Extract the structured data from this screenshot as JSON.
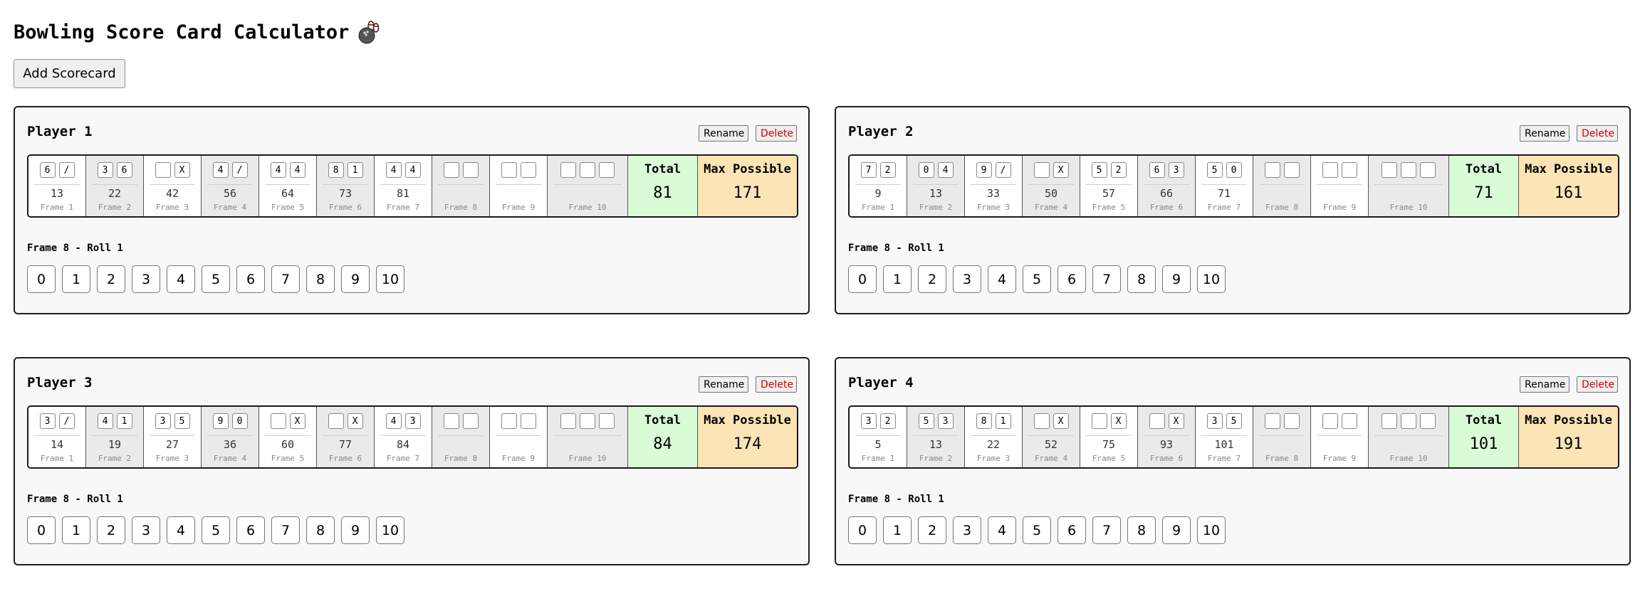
{
  "app": {
    "title": "Bowling Score Card Calculator",
    "add_label": "Add Scorecard",
    "rename_label": "Rename",
    "delete_label": "Delete",
    "total_label": "Total",
    "max_label": "Max Possible",
    "frame_labels": [
      "Frame 1",
      "Frame 2",
      "Frame 3",
      "Frame 4",
      "Frame 5",
      "Frame 6",
      "Frame 7",
      "Frame 8",
      "Frame 9",
      "Frame 10"
    ],
    "pin_options": [
      "0",
      "1",
      "2",
      "3",
      "4",
      "5",
      "6",
      "7",
      "8",
      "9",
      "10"
    ]
  },
  "players": [
    {
      "name": "Player 1",
      "frames": [
        {
          "rolls": [
            "6",
            "/"
          ],
          "score": "13"
        },
        {
          "rolls": [
            "3",
            "6"
          ],
          "score": "22"
        },
        {
          "rolls": [
            "",
            "X"
          ],
          "score": "42"
        },
        {
          "rolls": [
            "4",
            "/"
          ],
          "score": "56"
        },
        {
          "rolls": [
            "4",
            "4"
          ],
          "score": "64"
        },
        {
          "rolls": [
            "8",
            "1"
          ],
          "score": "73"
        },
        {
          "rolls": [
            "4",
            "4"
          ],
          "score": "81"
        },
        {
          "rolls": [
            "",
            ""
          ],
          "score": ""
        },
        {
          "rolls": [
            "",
            ""
          ],
          "score": ""
        },
        {
          "rolls": [
            "",
            "",
            ""
          ],
          "score": ""
        }
      ],
      "total": "81",
      "max_possible": "171",
      "prompt": "Frame 8 - Roll 1"
    },
    {
      "name": "Player 2",
      "frames": [
        {
          "rolls": [
            "7",
            "2"
          ],
          "score": "9"
        },
        {
          "rolls": [
            "0",
            "4"
          ],
          "score": "13"
        },
        {
          "rolls": [
            "9",
            "/"
          ],
          "score": "33"
        },
        {
          "rolls": [
            "",
            "X"
          ],
          "score": "50"
        },
        {
          "rolls": [
            "5",
            "2"
          ],
          "score": "57"
        },
        {
          "rolls": [
            "6",
            "3"
          ],
          "score": "66"
        },
        {
          "rolls": [
            "5",
            "0"
          ],
          "score": "71"
        },
        {
          "rolls": [
            "",
            ""
          ],
          "score": ""
        },
        {
          "rolls": [
            "",
            ""
          ],
          "score": ""
        },
        {
          "rolls": [
            "",
            "",
            ""
          ],
          "score": ""
        }
      ],
      "total": "71",
      "max_possible": "161",
      "prompt": "Frame 8 - Roll 1"
    },
    {
      "name": "Player 3",
      "frames": [
        {
          "rolls": [
            "3",
            "/"
          ],
          "score": "14"
        },
        {
          "rolls": [
            "4",
            "1"
          ],
          "score": "19"
        },
        {
          "rolls": [
            "3",
            "5"
          ],
          "score": "27"
        },
        {
          "rolls": [
            "9",
            "0"
          ],
          "score": "36"
        },
        {
          "rolls": [
            "",
            "X"
          ],
          "score": "60"
        },
        {
          "rolls": [
            "",
            "X"
          ],
          "score": "77"
        },
        {
          "rolls": [
            "4",
            "3"
          ],
          "score": "84"
        },
        {
          "rolls": [
            "",
            ""
          ],
          "score": ""
        },
        {
          "rolls": [
            "",
            ""
          ],
          "score": ""
        },
        {
          "rolls": [
            "",
            "",
            ""
          ],
          "score": ""
        }
      ],
      "total": "84",
      "max_possible": "174",
      "prompt": "Frame 8 - Roll 1"
    },
    {
      "name": "Player 4",
      "frames": [
        {
          "rolls": [
            "3",
            "2"
          ],
          "score": "5"
        },
        {
          "rolls": [
            "5",
            "3"
          ],
          "score": "13"
        },
        {
          "rolls": [
            "8",
            "1"
          ],
          "score": "22"
        },
        {
          "rolls": [
            "",
            "X"
          ],
          "score": "52"
        },
        {
          "rolls": [
            "",
            "X"
          ],
          "score": "75"
        },
        {
          "rolls": [
            "",
            "X"
          ],
          "score": "93"
        },
        {
          "rolls": [
            "3",
            "5"
          ],
          "score": "101"
        },
        {
          "rolls": [
            "",
            ""
          ],
          "score": ""
        },
        {
          "rolls": [
            "",
            ""
          ],
          "score": ""
        },
        {
          "rolls": [
            "",
            "",
            ""
          ],
          "score": ""
        }
      ],
      "total": "101",
      "max_possible": "191",
      "prompt": "Frame 8 - Roll 1"
    }
  ],
  "colors": {
    "total_bg": "#d9fbd6",
    "max_bg": "#fbe4b5",
    "delete_text": "#d40000",
    "shaded_frame": "#eaeaea"
  },
  "icons": {
    "title_icon": "bowling-ball-and-pins-icon"
  }
}
